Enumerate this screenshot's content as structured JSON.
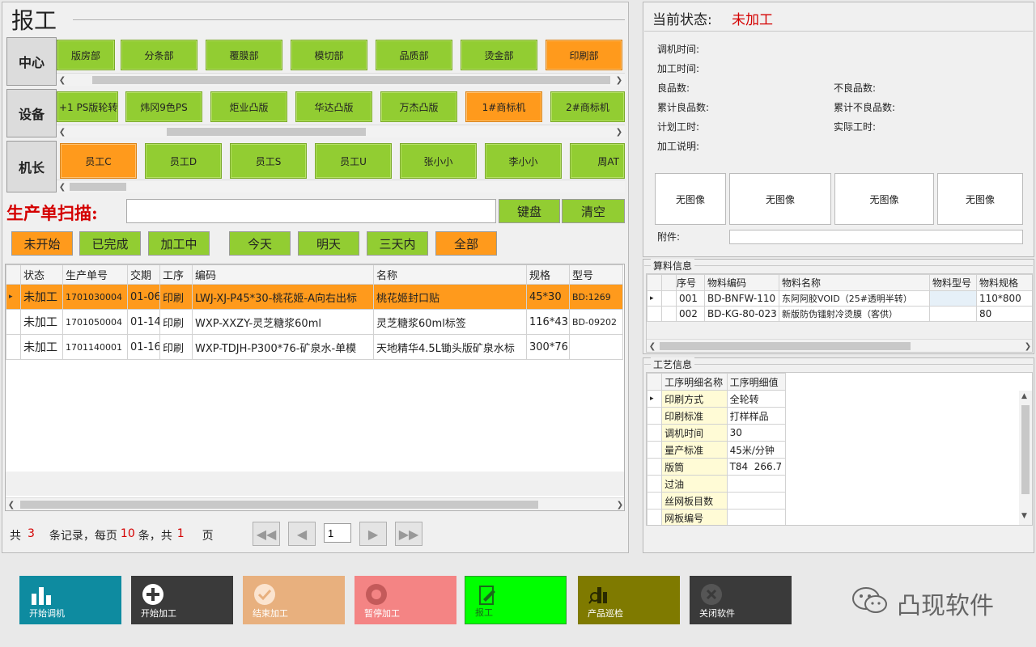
{
  "title": "报工",
  "rows": {
    "center_label": "中心",
    "device_label": "设备",
    "operator_label": "机长",
    "centers": [
      {
        "label": "版房部",
        "state": "green"
      },
      {
        "label": "分条部",
        "state": "green"
      },
      {
        "label": "覆膜部",
        "state": "green"
      },
      {
        "label": "模切部",
        "state": "green"
      },
      {
        "label": "品质部",
        "state": "green"
      },
      {
        "label": "烫金部",
        "state": "green"
      },
      {
        "label": "印刷部",
        "state": "orange"
      }
    ],
    "devices": [
      {
        "label": "+1 PS版轮转",
        "state": "green"
      },
      {
        "label": "炜冈9色PS",
        "state": "green"
      },
      {
        "label": "炬业凸版",
        "state": "green"
      },
      {
        "label": "华达凸版",
        "state": "green"
      },
      {
        "label": "万杰凸版",
        "state": "green"
      },
      {
        "label": "1#商标机",
        "state": "orange"
      },
      {
        "label": "2#商标机",
        "state": "green"
      }
    ],
    "operators": [
      {
        "label": "员工C",
        "state": "orange"
      },
      {
        "label": "员工D",
        "state": "green"
      },
      {
        "label": "员工S",
        "state": "green"
      },
      {
        "label": "员工U",
        "state": "green"
      },
      {
        "label": "张小小",
        "state": "green"
      },
      {
        "label": "李小小",
        "state": "green"
      },
      {
        "label": "周AT",
        "state": "green"
      }
    ]
  },
  "scan": {
    "label": "生产单扫描:",
    "value": "",
    "keyboard": "键盘",
    "clear": "清空"
  },
  "filters": [
    "未开始",
    "已完成",
    "加工中",
    "今天",
    "明天",
    "三天内",
    "全部"
  ],
  "orders": {
    "headers": [
      "状态",
      "生产单号",
      "交期",
      "工序",
      "编码",
      "名称",
      "规格",
      "型号"
    ],
    "rows": [
      [
        "未加工",
        "1701030004",
        "01-06",
        "印刷",
        "LWJ-XJ-P45*30-桃花姬-A向右出标",
        "桃花姬封口贴",
        "45*30",
        "BD:1269"
      ],
      [
        "未加工",
        "1701050004",
        "01-14",
        "印刷",
        "WXP-XXZY-灵芝糖浆60ml",
        "灵芝糖浆60ml标签",
        "116*43",
        "BD-09202"
      ],
      [
        "未加工",
        "1701140001",
        "01-16",
        "印刷",
        "WXP-TDJH-P300*76-矿泉水-单模",
        "天地精华4.5L锄头版矿泉水标",
        "300*76",
        ""
      ]
    ]
  },
  "pager": {
    "total_prefix": "共",
    "total": "3",
    "mid1": "条记录，每页",
    "per_page": "10",
    "mid2": "条，共",
    "pages": "1",
    "suffix": "页",
    "current": "1"
  },
  "status": {
    "label": "当前状态:",
    "value": "未加工",
    "fields": {
      "setup_time": "调机时间:",
      "process_time": "加工时间:",
      "good_qty": "良品数:",
      "bad_qty": "不良品数:",
      "cum_good": "累计良品数:",
      "cum_bad": "累计不良品数:",
      "plan_hours": "计划工时:",
      "actual_hours": "实际工时:",
      "process_note": "加工说明:"
    },
    "images": [
      "无图像",
      "无图像",
      "无图像",
      "无图像"
    ],
    "attachment_label": "附件:"
  },
  "materials": {
    "legend": "算料信息",
    "headers": [
      "序号",
      "物料编码",
      "物料名称",
      "物料型号",
      "物料规格"
    ],
    "rows": [
      [
        "001",
        "BD-BNFW-110",
        "东阿阿胶VOID（25#透明半转）",
        "",
        "110*800"
      ],
      [
        "002",
        "BD-KG-80-023",
        "新版防伪镭射冷烫膜（客供）",
        "",
        "80"
      ]
    ]
  },
  "process": {
    "legend": "工艺信息",
    "headers": [
      "工序明细名称",
      "工序明细值"
    ],
    "rows": [
      [
        "印刷方式",
        "全轮转"
      ],
      [
        "印刷标准",
        "打样样品"
      ],
      [
        "调机时间",
        "30"
      ],
      [
        "量产标准",
        "45米/分钟"
      ],
      [
        "版筒",
        "T84  266.7"
      ],
      [
        "过油",
        ""
      ],
      [
        "丝网板目数",
        ""
      ],
      [
        "网板编号",
        ""
      ]
    ]
  },
  "actions": [
    {
      "label": "开始调机",
      "icon": "bar-chart-icon",
      "color": "#0e8ba0"
    },
    {
      "label": "开始加工",
      "icon": "plus-circle-icon",
      "color": "#3a3a3a"
    },
    {
      "label": "结束加工",
      "icon": "check-circle-icon",
      "color": "#e8b07e"
    },
    {
      "label": "暂停加工",
      "icon": "pause-circle-icon",
      "color": "#f48484"
    },
    {
      "label": "报工",
      "icon": "edit-icon",
      "color": "#00ff00"
    },
    {
      "label": "产品巡检",
      "icon": "inspect-icon",
      "color": "#7f7a00"
    },
    {
      "label": "关闭软件",
      "icon": "close-circle-icon",
      "color": "#3a3a3a"
    }
  ],
  "brand": "凸现软件",
  "colors": {
    "green": "#92cd32",
    "orange": "#ff9a1c",
    "red_text": "#d40000"
  }
}
